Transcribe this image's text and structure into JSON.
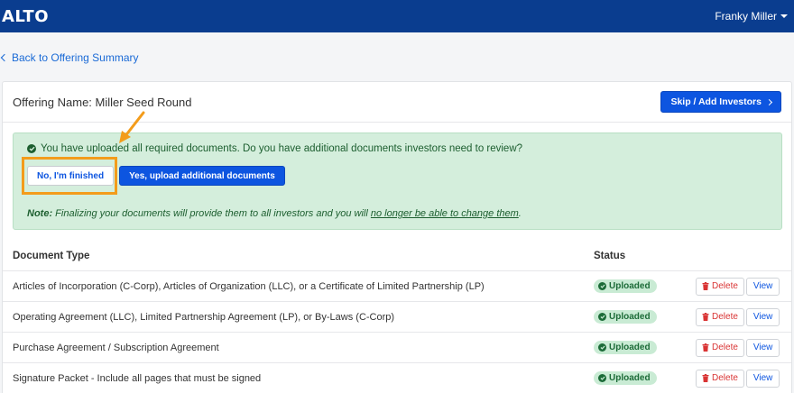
{
  "navbar": {
    "logo": "ALTO",
    "user_name": "Franky Miller"
  },
  "back_link": {
    "label": "Back to Offering Summary"
  },
  "offering": {
    "title": "Offering Name: Miller Seed Round",
    "skip_button": "Skip / Add Investors"
  },
  "alert": {
    "message": "You have uploaded all required documents. Do you have additional documents investors need to review?",
    "no_button": "No, I'm finished",
    "yes_button": "Yes, upload additional documents",
    "note_label": "Note:",
    "note_text": " Finalizing your documents will provide them to all investors and you will ",
    "note_underlined": "no longer be able to change them",
    "note_end": "."
  },
  "table": {
    "headers": {
      "document_type": "Document Type",
      "status": "Status"
    },
    "rows": [
      {
        "document": "Articles of Incorporation (C-Corp), Articles of Organization (LLC), or a Certificate of Limited Partnership (LP)",
        "status": "Uploaded"
      },
      {
        "document": "Operating Agreement (LLC), Limited Partnership Agreement (LP), or By-Laws (C-Corp)",
        "status": "Uploaded"
      },
      {
        "document": "Purchase Agreement / Subscription Agreement",
        "status": "Uploaded"
      },
      {
        "document": "Signature Packet - Include all pages that must be signed",
        "status": "Uploaded"
      }
    ],
    "delete_label": "Delete",
    "view_label": "View"
  },
  "colors": {
    "navbar": "#0a3d8f",
    "primary": "#0d55e0",
    "alert_bg": "#d4eedc",
    "highlight": "#f39c1b",
    "danger": "#d93434"
  }
}
